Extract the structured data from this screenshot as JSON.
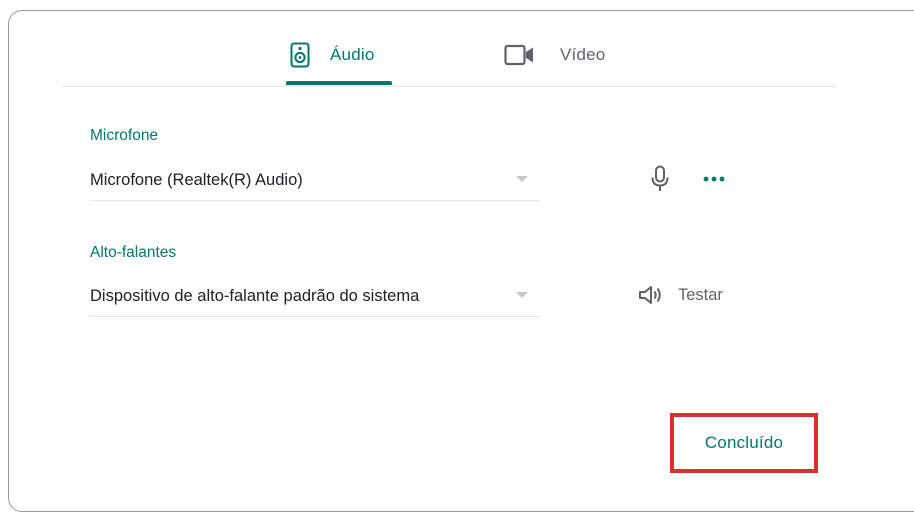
{
  "tabs": [
    {
      "label": "Áudio",
      "icon": "speaker-icon",
      "selected": true
    },
    {
      "label": "Vídeo",
      "icon": "video-camera-icon",
      "selected": false
    }
  ],
  "microphone": {
    "label": "Microfone",
    "selected": "Microfone (Realtek(R) Audio)",
    "icon": "microphone-icon",
    "more_icon": "more-horizontal-icon"
  },
  "speakers": {
    "label": "Alto-falantes",
    "selected": "Dispositivo de alto-falante padrão do sistema",
    "test_label": "Testar",
    "test_icon": "volume-icon"
  },
  "footer": {
    "done_label": "Concluído"
  },
  "colors": {
    "accent": "#00796b",
    "highlight": "#e0302b",
    "text_primary": "#202124",
    "text_secondary": "#5f6368"
  }
}
